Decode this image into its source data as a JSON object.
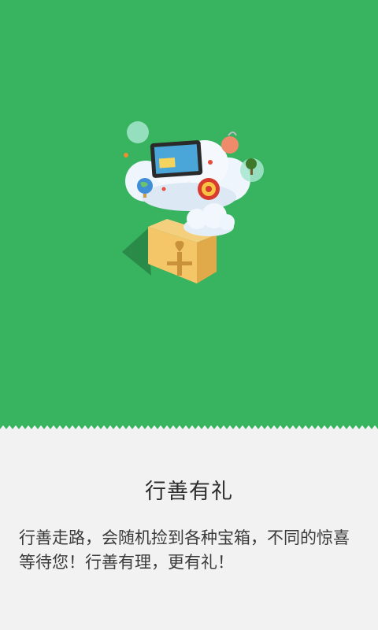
{
  "intro": {
    "title": "行善有礼",
    "description": "行善走路，会随机捡到各种宝箱，不同的惊喜等待您！行善有理，更有礼！"
  },
  "colors": {
    "hero_background": "#38b35f",
    "page_background": "#f2f2f2"
  },
  "icons": [
    "cloud-icon",
    "gift-box-icon",
    "tablet-icon",
    "globe-icon",
    "fu-charm-icon",
    "tree-icon",
    "tag-icon"
  ]
}
